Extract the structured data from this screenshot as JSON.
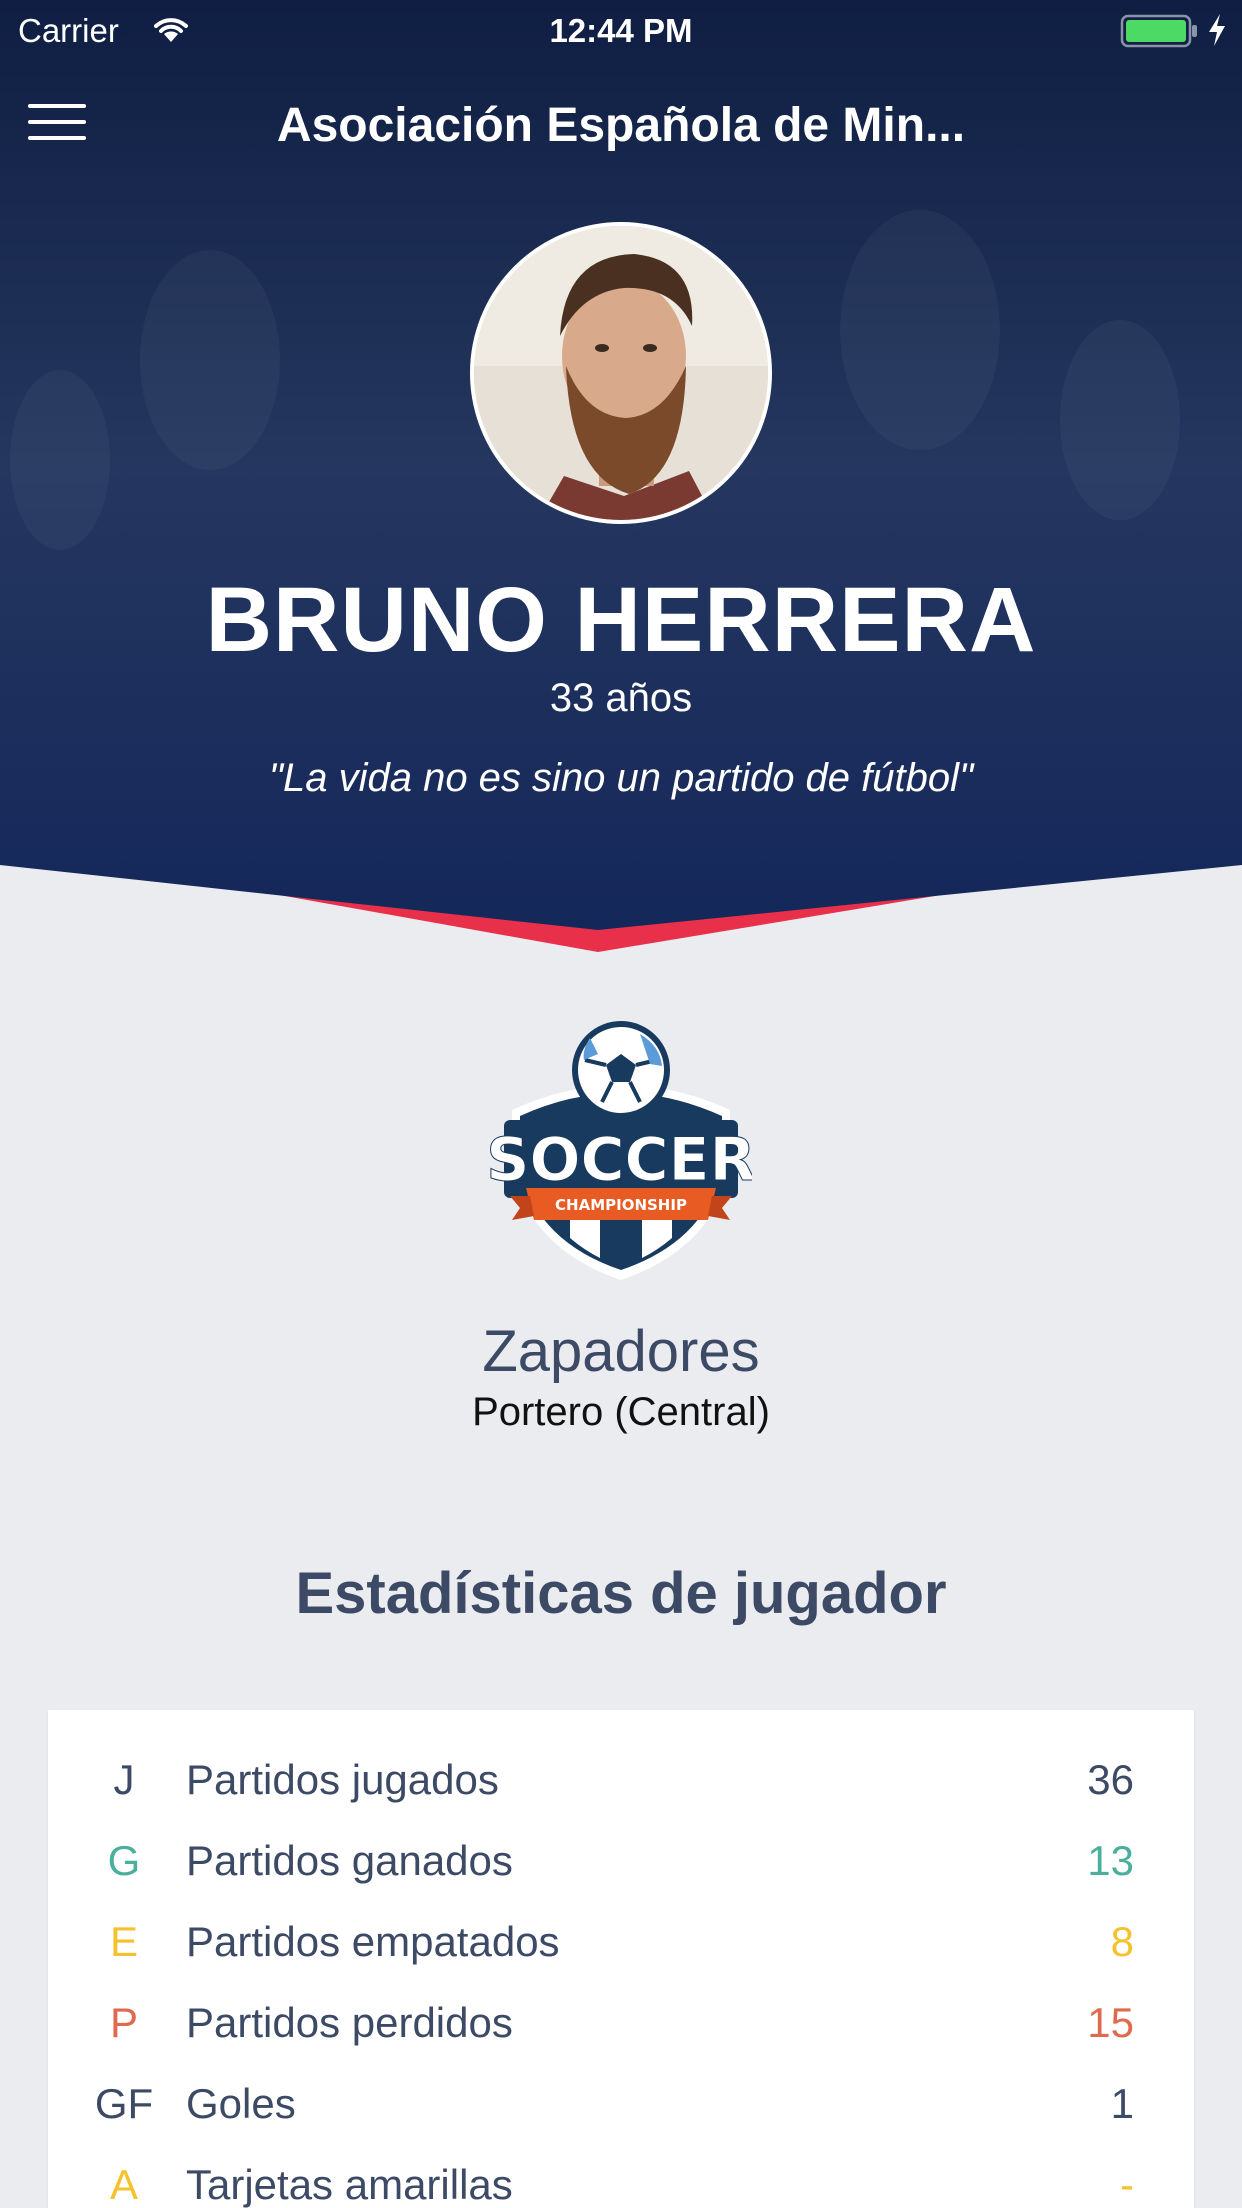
{
  "status_bar": {
    "carrier": "Carrier",
    "time": "12:44 PM"
  },
  "nav": {
    "title": "Asociación Española de Min..."
  },
  "player": {
    "name": "BRUNO HERRERA",
    "age": "33 años",
    "quote": "\"La vida no es sino un partido de fútbol\""
  },
  "team": {
    "logo_text": "SOCCER",
    "logo_subtext": "CHAMPIONSHIP",
    "name": "Zapadores",
    "position": "Portero (Central)"
  },
  "stats": {
    "heading": "Estadísticas de jugador",
    "rows": [
      {
        "abbr": "J",
        "label": "Partidos jugados",
        "value": "36",
        "color": "#3d4a66"
      },
      {
        "abbr": "G",
        "label": "Partidos ganados",
        "value": "13",
        "color": "#4aaf9b"
      },
      {
        "abbr": "E",
        "label": "Partidos empatados",
        "value": "8",
        "color": "#f5c22b"
      },
      {
        "abbr": "P",
        "label": "Partidos perdidos",
        "value": "15",
        "color": "#e06a4e"
      },
      {
        "abbr": "GF",
        "label": "Goles",
        "value": "1",
        "color": "#3d4a66"
      },
      {
        "abbr": "A",
        "label": "Tarjetas amarillas",
        "value": "-",
        "color": "#f5c22b"
      }
    ]
  },
  "colors": {
    "header_dark": "#13234a",
    "accent_red": "#e8304a",
    "page_bg": "#ebecf0"
  }
}
